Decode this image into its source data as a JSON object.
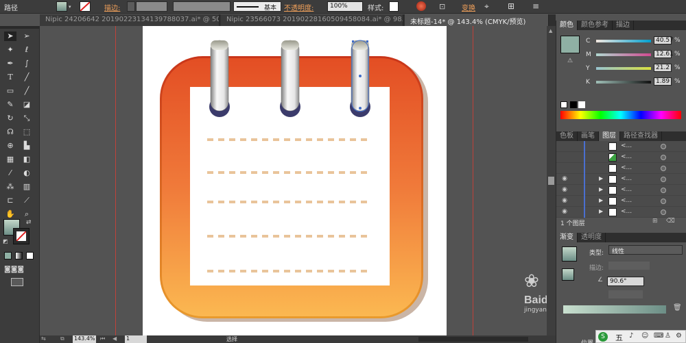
{
  "control_bar": {
    "path_label": "路径",
    "stroke_label": "描边:",
    "stroke_style_label": "基本",
    "opacity_label": "不透明度:",
    "opacity_value": "100%",
    "style_label": "样式:",
    "transform_label": "变换"
  },
  "document_tabs": [
    {
      "label": "Nipic 24206642 20190223134139788037.ai* @ 50..."
    },
    {
      "label": "Nipic 23566073 20190228160509458084.ai* @ 98..."
    },
    {
      "label": "未标题-14* @ 143.4% (CMYK/预览)"
    }
  ],
  "statusbar": {
    "zoom": "143.4%",
    "page": "1",
    "tool_name": "选择"
  },
  "color_panel": {
    "tabs": [
      "颜色",
      "颜色参考",
      "描边"
    ],
    "sliders": [
      {
        "label": "C",
        "value": "40.57"
      },
      {
        "label": "M",
        "value": "12.61"
      },
      {
        "label": "Y",
        "value": "21.2"
      },
      {
        "label": "K",
        "value": "1.89"
      }
    ],
    "percent_sign": "%"
  },
  "layers_panel": {
    "tabs": [
      "色板",
      "画笔",
      "图层",
      "路径查找器"
    ],
    "item_label": "<...",
    "rows": 7,
    "footer": "1 个图层"
  },
  "gradient_panel": {
    "tabs": [
      "渐变",
      "透明度"
    ],
    "type_label": "类型:",
    "type_value": "线性",
    "stroke_label": "描边:",
    "angle_value": "90.6°",
    "location_label": "位置"
  },
  "watermark": {
    "text": "Baidu 经验",
    "sub": "jingyan.baidu.com"
  },
  "taskbar": {
    "ime": "五"
  },
  "colors": {
    "accent": "#e8522a",
    "icon_top": "#e34e24",
    "icon_bottom": "#fbb851",
    "dash": "#e9c49a",
    "ring": "#3b3b6b"
  }
}
